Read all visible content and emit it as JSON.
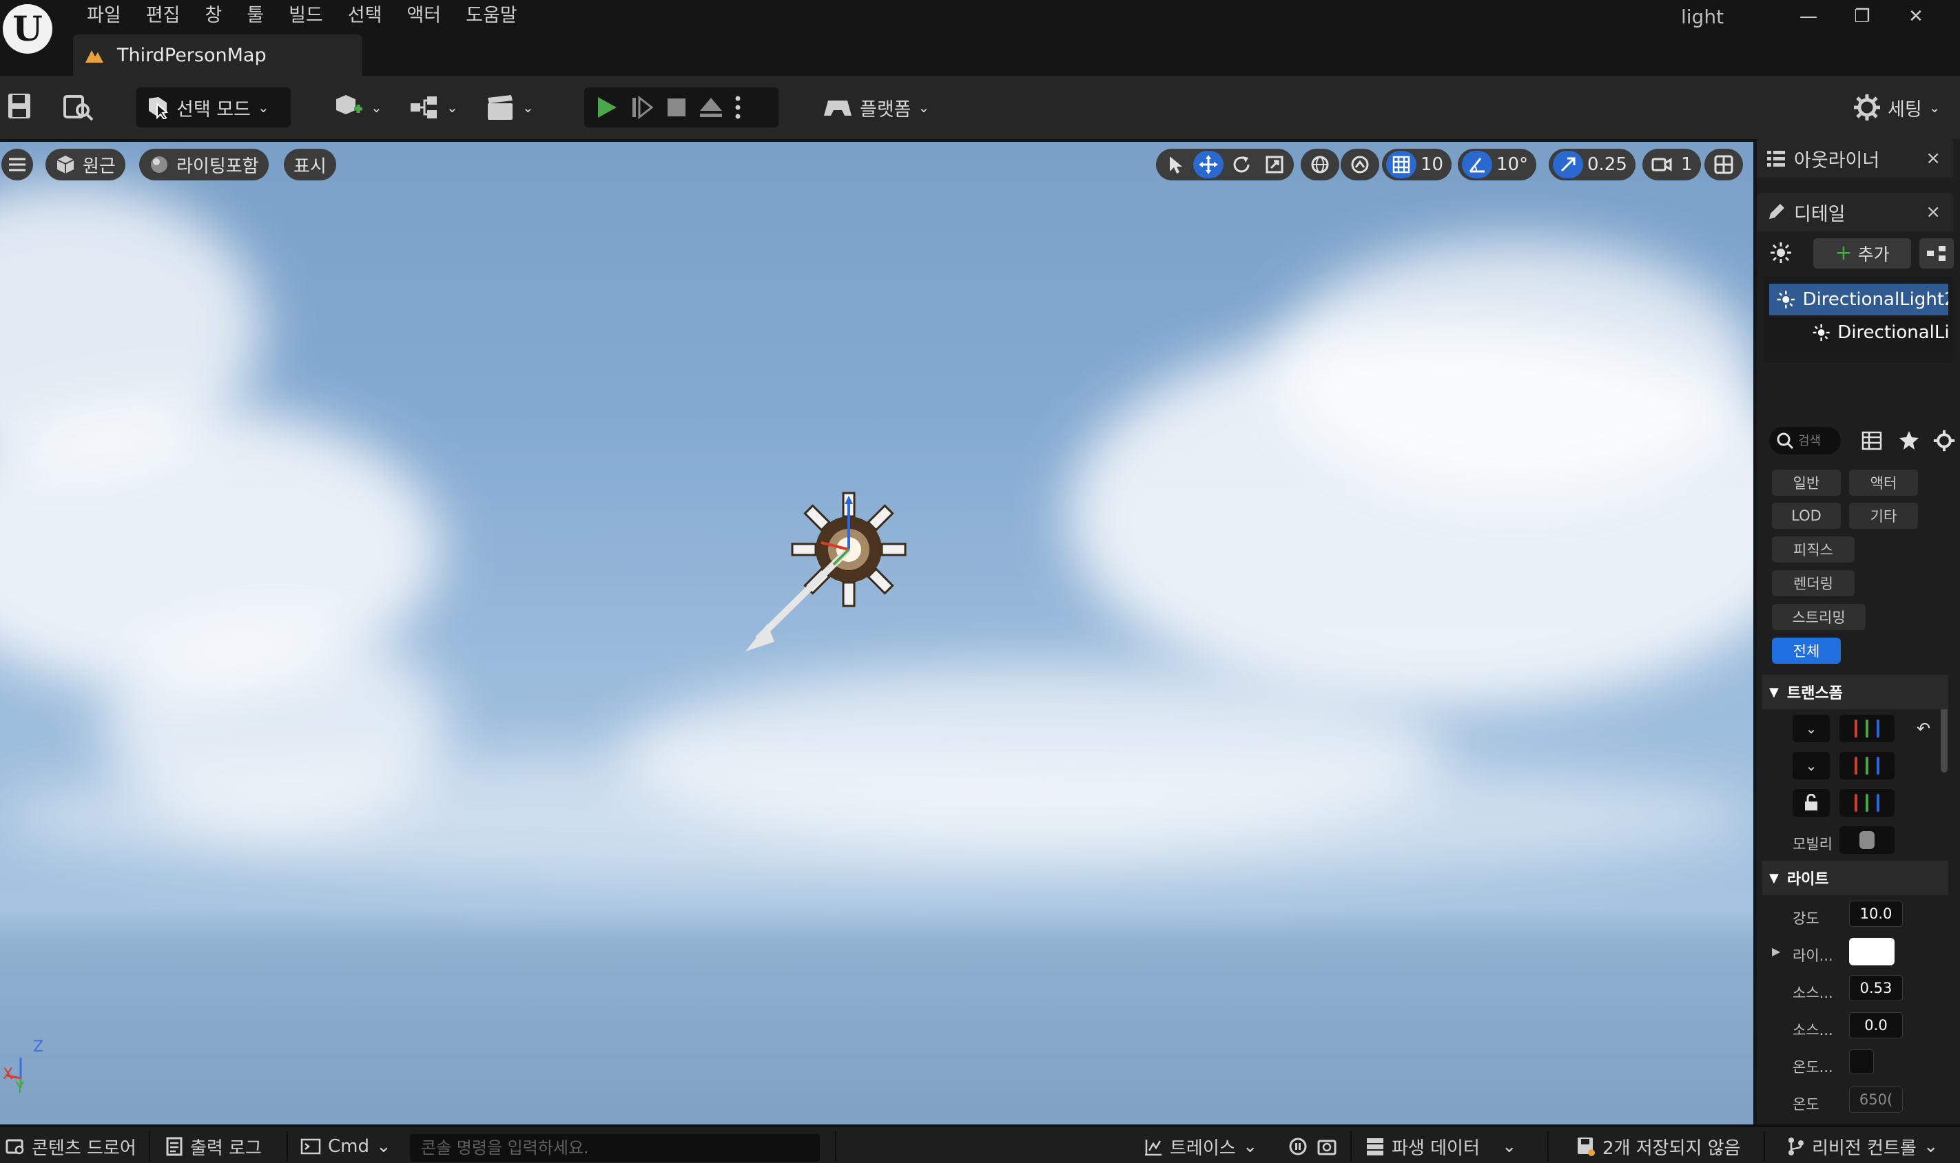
{
  "window": {
    "project_name": "light",
    "minimize": "—",
    "restore": "❐",
    "close": "✕"
  },
  "menu": [
    "파일",
    "편집",
    "창",
    "툴",
    "빌드",
    "선택",
    "액터",
    "도움말"
  ],
  "map_tab": {
    "label": "ThirdPersonMap"
  },
  "toolbar": {
    "select_mode": "선택 모드",
    "platform": "플랫폼",
    "settings": "세팅"
  },
  "viewport": {
    "perspective": "원근",
    "lighting": "라이팅포함",
    "show": "표시",
    "grid_snap": "10",
    "rotation_snap": "10°",
    "scale_snap": "0.25",
    "camera_speed": "1",
    "axis_z": "Z",
    "axis_x": "X",
    "axis_y": "Y"
  },
  "outliner": {
    "title": "아웃라이너",
    "close": "×"
  },
  "details": {
    "title": "디테일",
    "close": "×",
    "add_button": "추가",
    "components": [
      "DirectionalLight2",
      "DirectionalLig"
    ],
    "search_placeholder": "검색",
    "filters": [
      "일반",
      "액터",
      "LOD",
      "기타",
      "피직스",
      "렌더링",
      "스트리밍",
      "전체"
    ],
    "sections": {
      "transform": "트랜스폼",
      "light": "라이트"
    },
    "transform_props": {
      "mobility": "모빌리"
    },
    "light_props": [
      {
        "label": "강도",
        "value": "10.0"
      },
      {
        "label": "라이...",
        "value": ""
      },
      {
        "label": "소스...",
        "value": "0.53"
      },
      {
        "label": "소스...",
        "value": "0.0"
      },
      {
        "label": "온도...",
        "value": ""
      },
      {
        "label": "온도",
        "value": "650("
      }
    ]
  },
  "statusbar": {
    "content_drawer": "콘텐츠 드로어",
    "output_log": "출력 로그",
    "cmd": "Cmd",
    "console_placeholder": "콘솔 명령을 입력하세요.",
    "trace": "트레이스",
    "derived_data": "파생 데이터",
    "unsaved": "2개 저장되지 않음",
    "revision_control": "리비전 컨트롤"
  },
  "colors": {
    "accent_blue": "#2a6ad0",
    "play_green": "#4ca64c",
    "panel_bg": "#1e1e1e",
    "title_bg": "#151515"
  }
}
